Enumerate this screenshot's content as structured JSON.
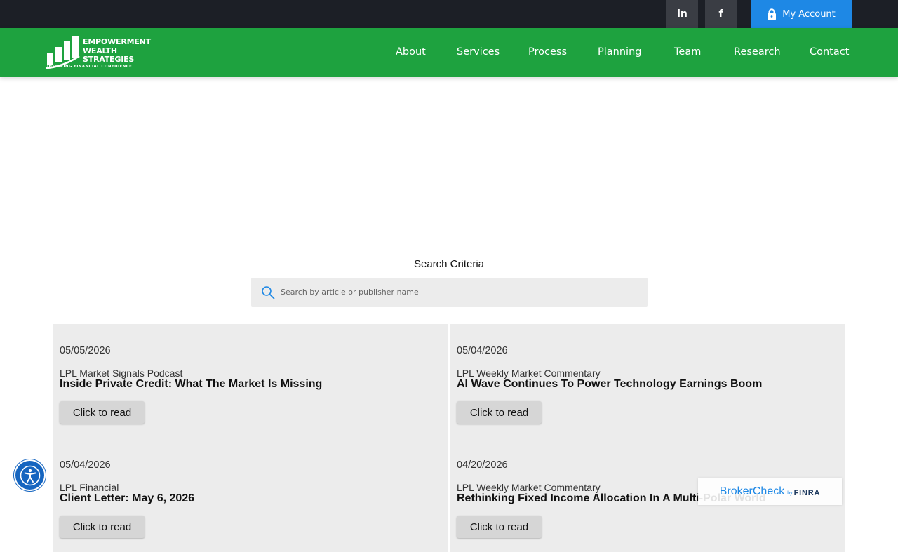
{
  "topbar": {
    "linkedin_label": "in",
    "facebook_label": "f",
    "account_label": "My Account"
  },
  "logo": {
    "line1": "EMPOWERMENT",
    "line2": "WEALTH",
    "line3": "STRATEGIES",
    "tagline": "INSPIRING FINANCIAL CONFIDENCE"
  },
  "nav": {
    "items": [
      {
        "label": "About"
      },
      {
        "label": "Services"
      },
      {
        "label": "Process"
      },
      {
        "label": "Planning"
      },
      {
        "label": "Team"
      },
      {
        "label": "Research"
      },
      {
        "label": "Contact"
      }
    ]
  },
  "search": {
    "title": "Search Criteria",
    "placeholder": "Search by article or publisher name"
  },
  "articles": [
    {
      "date": "05/05/2026",
      "publisher": "LPL Market Signals Podcast",
      "title": "Inside Private Credit: What The Market Is Missing",
      "button": "Click to read"
    },
    {
      "date": "05/04/2026",
      "publisher": "LPL Weekly Market Commentary",
      "title": "AI Wave Continues To Power Technology Earnings Boom",
      "button": "Click to read"
    },
    {
      "date": "05/04/2026",
      "publisher": "LPL Financial",
      "title": "Client Letter: May 6, 2026",
      "button": "Click to read"
    },
    {
      "date": "04/20/2026",
      "publisher": "LPL Weekly Market Commentary",
      "title": "Rethinking Fixed Income Allocation In A Multi-Polar World",
      "button": "Click to read"
    }
  ],
  "brokercheck": {
    "brand": "BrokerCheck",
    "by": "by",
    "finra": "FINRA"
  },
  "colors": {
    "topbar": "#1c1f26",
    "nav_green": "#1ea23f",
    "account_blue": "#1e88e5",
    "card_bg": "#ececec",
    "a11y_blue": "#1565c0"
  }
}
